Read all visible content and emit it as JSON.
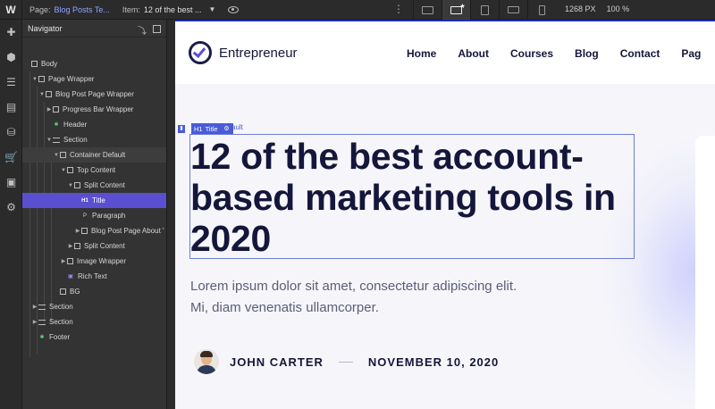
{
  "topbar": {
    "logo": "W",
    "page_label": "Page:",
    "page_value": "Blog Posts Te...",
    "item_label": "Item:",
    "item_value": "12 of the best ...",
    "width_value": "1268",
    "width_unit": "PX",
    "zoom": "100 %"
  },
  "navigator": {
    "title": "Navigator",
    "rows": [
      {
        "label": "Body"
      },
      {
        "label": "Page Wrapper"
      },
      {
        "label": "Blog Post Page Wrapper"
      },
      {
        "label": "Progress Bar Wrapper"
      },
      {
        "label": "Header"
      },
      {
        "label": "Section"
      },
      {
        "label": "Container Default"
      },
      {
        "label": "Top Content"
      },
      {
        "label": "Split Content"
      },
      {
        "label": "Title"
      },
      {
        "label": "Paragraph"
      },
      {
        "label": "Blog Post Page About '"
      },
      {
        "label": "Split Content"
      },
      {
        "label": "Image Wrapper"
      },
      {
        "label": "Rich Text"
      },
      {
        "label": "BG"
      },
      {
        "label": "Section"
      },
      {
        "label": "Section"
      },
      {
        "label": "Footer"
      }
    ],
    "h1_badge": "H1",
    "p_badge": "P"
  },
  "site": {
    "brand": "Entrepreneur",
    "menu": [
      "Home",
      "About",
      "Courses",
      "Blog",
      "Contact",
      "Pag"
    ],
    "selection_tag": "Title",
    "selection_tag_prefix": "H1",
    "ghost_label": "ault",
    "title": "12 of the best account-based marketing tools in 2020",
    "subtitle_line1": "Lorem ipsum dolor sit amet, consectetur adipiscing elit.",
    "subtitle_line2": "Mi, diam venenatis ullamcorper.",
    "author": "JOHN CARTER",
    "date": "NOVEMBER 10, 2020"
  },
  "colors": {
    "accent": "#5a4fd1",
    "selection": "#4a5bd8",
    "ink": "#14163b"
  }
}
